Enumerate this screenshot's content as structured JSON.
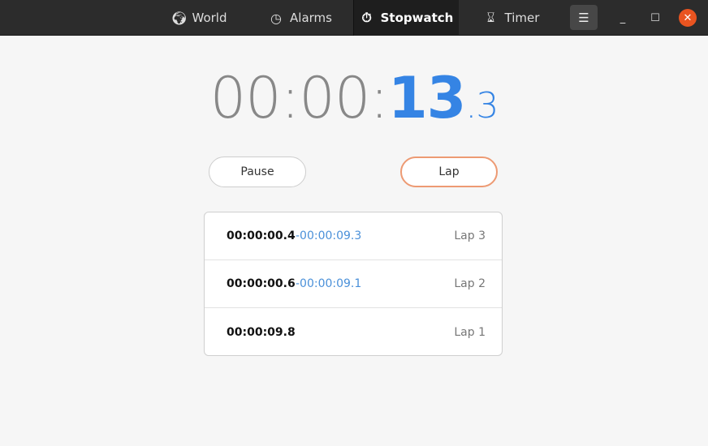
{
  "tabs": [
    {
      "label": "World",
      "icon": "globe-icon"
    },
    {
      "label": "Alarms",
      "icon": "alarm-clock-icon"
    },
    {
      "label": "Stopwatch",
      "icon": "stopwatch-icon",
      "active": true
    },
    {
      "label": "Timer",
      "icon": "hourglass-icon"
    }
  ],
  "display": {
    "hm": "00:00:",
    "sec": "13",
    "tenths": ".3"
  },
  "buttons": {
    "pause": "Pause",
    "lap": "Lap"
  },
  "laps": [
    {
      "time": "00:00:00.4",
      "diff": "-00:00:09.3",
      "label": "Lap 3"
    },
    {
      "time": "00:00:00.6",
      "diff": "-00:00:09.1",
      "label": "Lap 2"
    },
    {
      "time": "00:00:09.8",
      "diff": "",
      "label": "Lap 1"
    }
  ],
  "colors": {
    "accent": "#3584e4",
    "close": "#e95420",
    "lap_border": "#ed9a73"
  }
}
